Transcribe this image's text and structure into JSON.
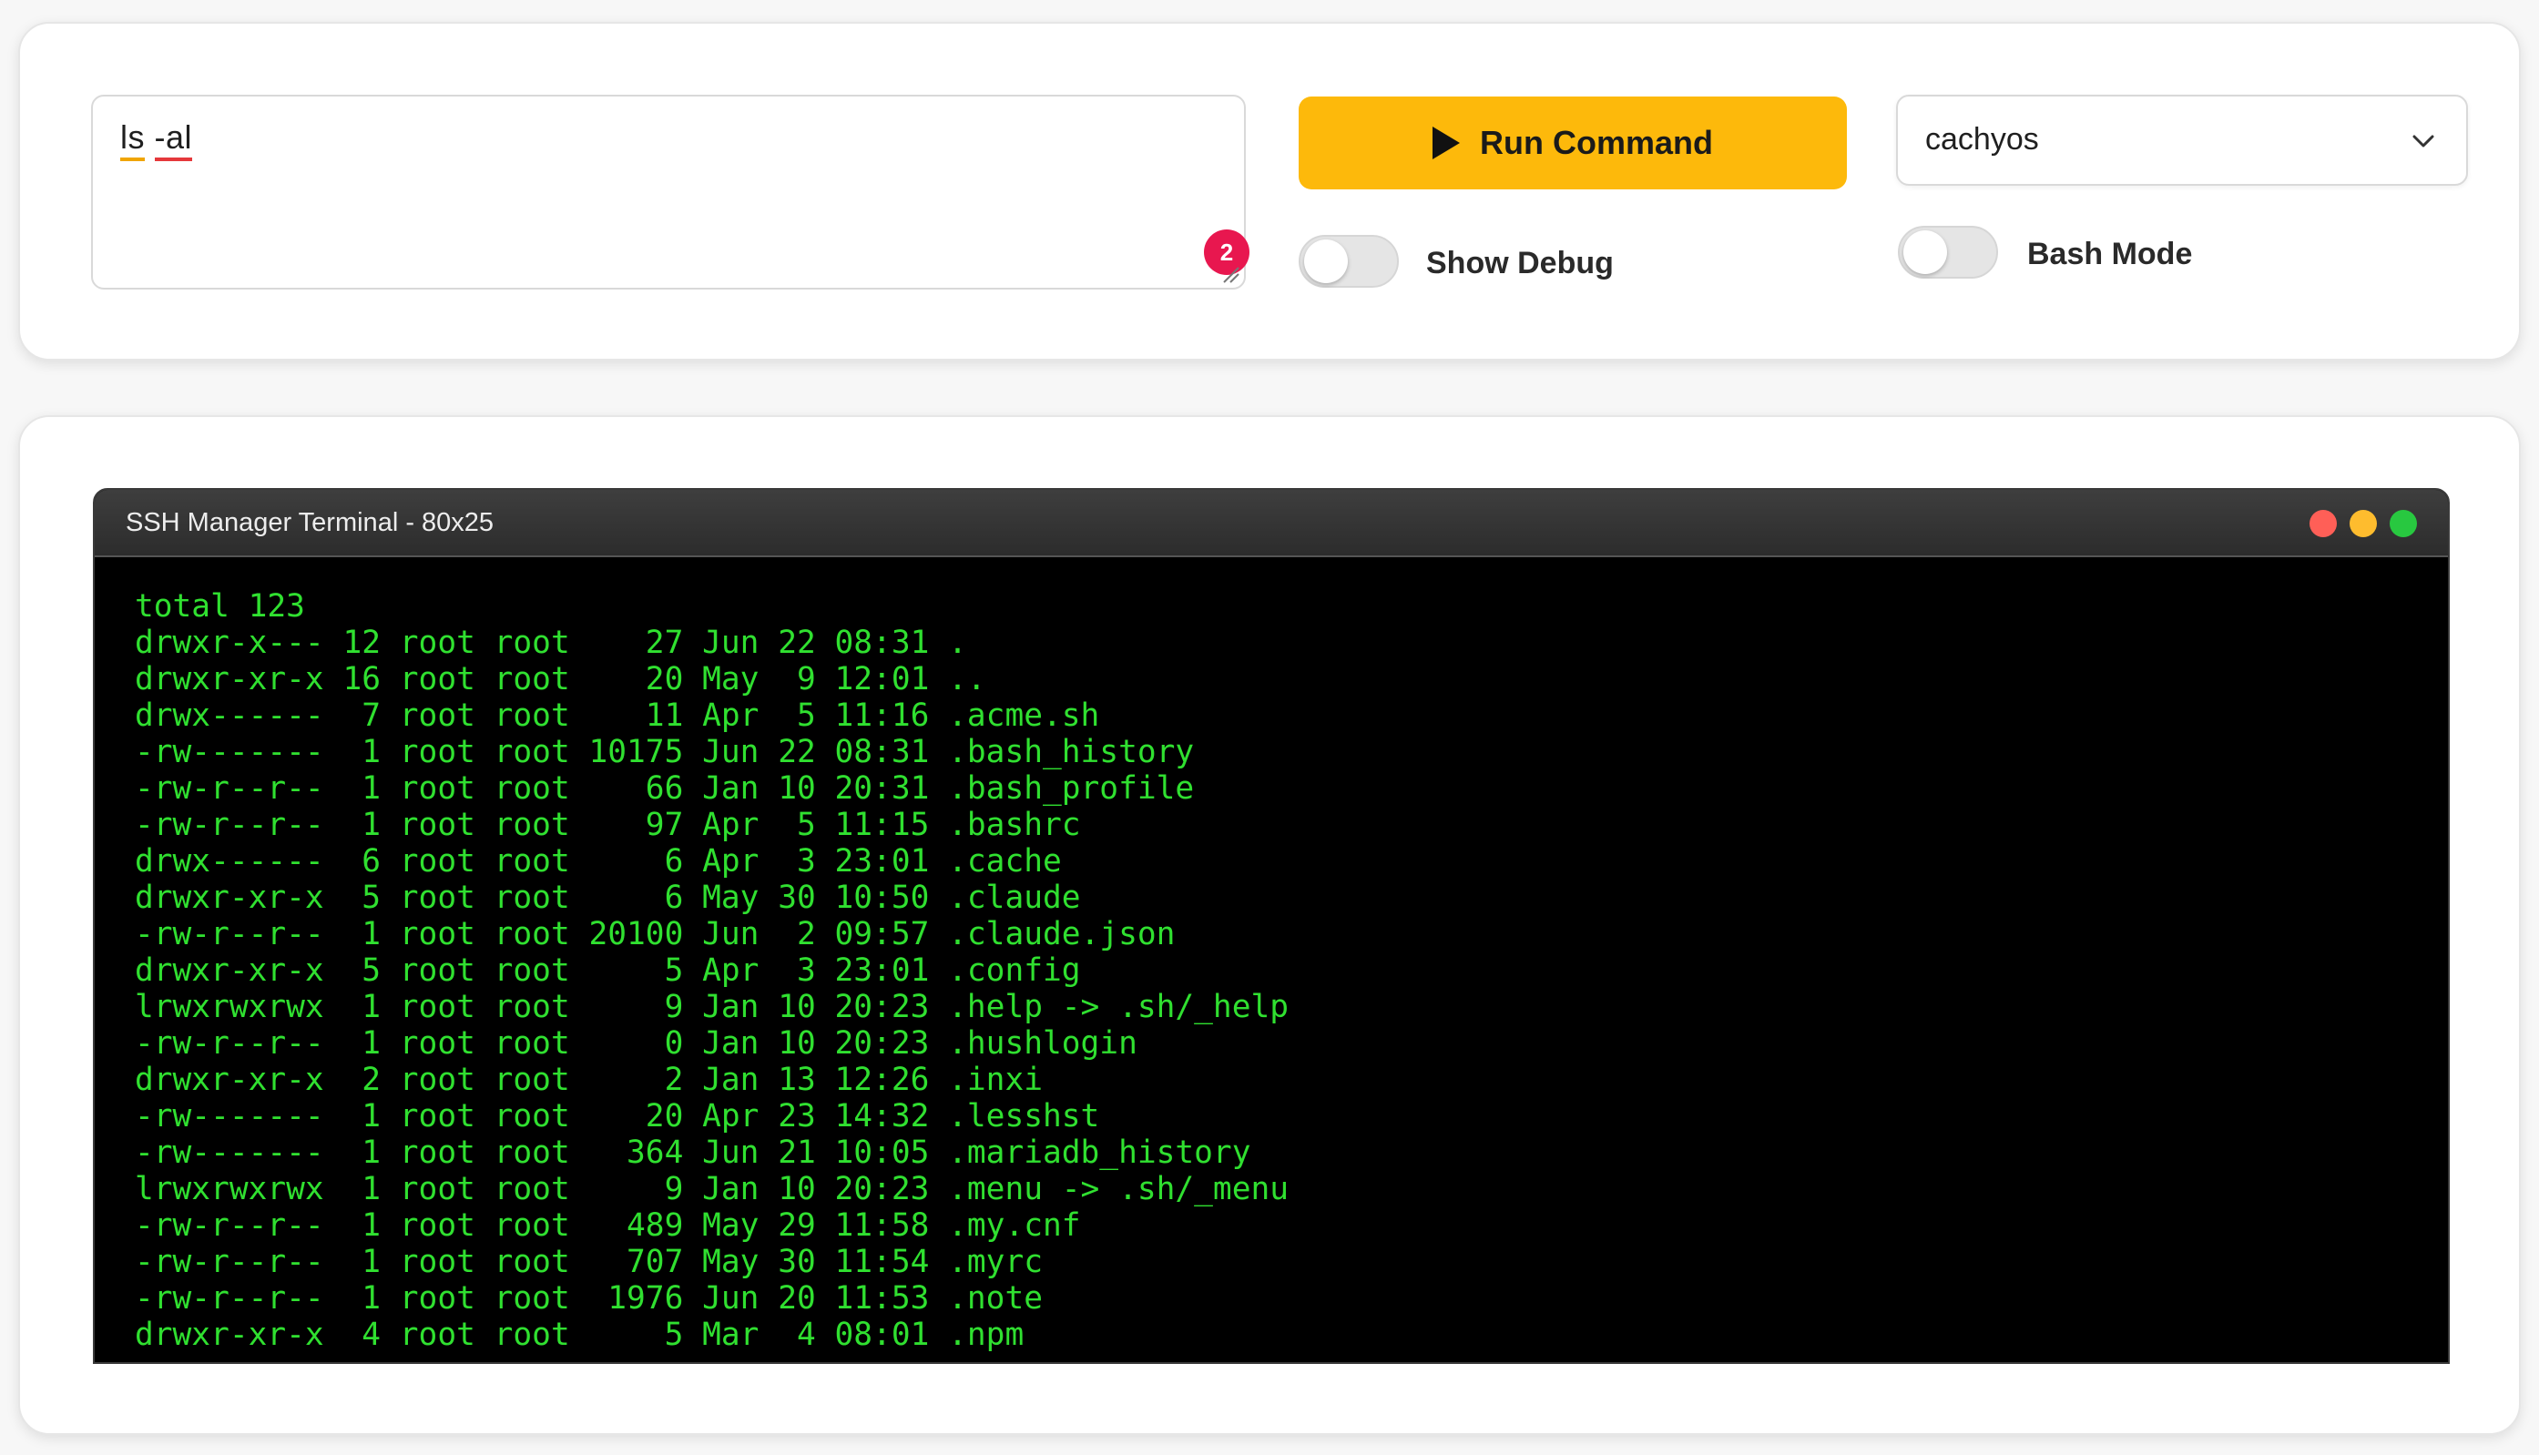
{
  "command_input": {
    "value_word1": "ls",
    "value_word2": "-al",
    "badge_count": "2"
  },
  "run_button": {
    "label": "Run Command",
    "icon": "play-icon",
    "color": "#fdb90b"
  },
  "host_select": {
    "selected": "cachyos",
    "icon": "chevron-down-icon"
  },
  "toggles": {
    "show_debug": {
      "label": "Show Debug",
      "on": false
    },
    "bash_mode": {
      "label": "Bash Mode",
      "on": false
    }
  },
  "terminal": {
    "title": "SSH Manager Terminal - 80x25",
    "text_color": "#30e030",
    "lines": [
      "total 123",
      "drwxr-x--- 12 root root    27 Jun 22 08:31 .",
      "drwxr-xr-x 16 root root    20 May  9 12:01 ..",
      "drwx------  7 root root    11 Apr  5 11:16 .acme.sh",
      "-rw-------  1 root root 10175 Jun 22 08:31 .bash_history",
      "-rw-r--r--  1 root root    66 Jan 10 20:31 .bash_profile",
      "-rw-r--r--  1 root root    97 Apr  5 11:15 .bashrc",
      "drwx------  6 root root     6 Apr  3 23:01 .cache",
      "drwxr-xr-x  5 root root     6 May 30 10:50 .claude",
      "-rw-r--r--  1 root root 20100 Jun  2 09:57 .claude.json",
      "drwxr-xr-x  5 root root     5 Apr  3 23:01 .config",
      "lrwxrwxrwx  1 root root     9 Jan 10 20:23 .help -> .sh/_help",
      "-rw-r--r--  1 root root     0 Jan 10 20:23 .hushlogin",
      "drwxr-xr-x  2 root root     2 Jan 13 12:26 .inxi",
      "-rw-------  1 root root    20 Apr 23 14:32 .lesshst",
      "-rw-------  1 root root   364 Jun 21 10:05 .mariadb_history",
      "lrwxrwxrwx  1 root root     9 Jan 10 20:23 .menu -> .sh/_menu",
      "-rw-r--r--  1 root root   489 May 29 11:58 .my.cnf",
      "-rw-r--r--  1 root root   707 May 30 11:54 .myrc",
      "-rw-r--r--  1 root root  1976 Jun 20 11:53 .note",
      "drwxr-xr-x  4 root root     5 Mar  4 08:01 .npm"
    ]
  }
}
